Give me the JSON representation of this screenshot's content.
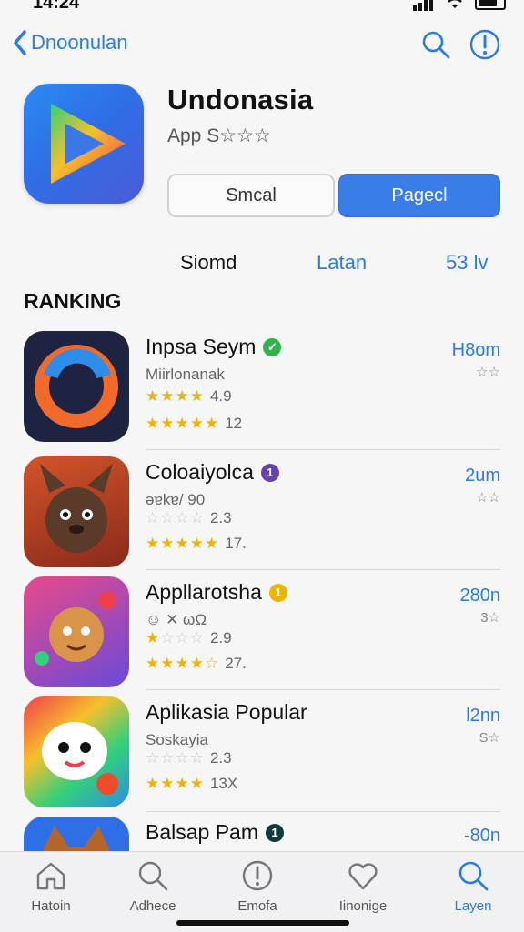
{
  "status": {
    "time": "14:24"
  },
  "nav": {
    "back_label": "Dnoonulan"
  },
  "app": {
    "title": "Undonasia",
    "subtitle": "App S☆☆☆",
    "button_outline": "Smcal",
    "button_primary": "Pagecl"
  },
  "tabs": [
    "Siomd",
    "Latan",
    "53 lv"
  ],
  "section_title": "RANKING",
  "apps": [
    {
      "name": "Inpsa Seym",
      "developer": "Miirlonanak",
      "rating1": "4.9",
      "rating2": "12",
      "right": "H8om",
      "right2": "☆☆",
      "badge_color": "#2fb34a",
      "badge_text": "✓"
    },
    {
      "name": "Coloaiyolca",
      "developer": "ǝɐkɐ/ 90",
      "rating1": "2.3",
      "rating2": "17.",
      "right": "2um",
      "right2": "☆☆",
      "badge_color": "#6a3fb0",
      "badge_text": "1"
    },
    {
      "name": "Appllarotsha",
      "developer": "☺ ✕ ωΩ",
      "rating1": "2.9",
      "rating2": "27.",
      "right": "280n",
      "right2": "3☆",
      "badge_color": "#f0b400",
      "badge_text": "1"
    },
    {
      "name": "Aplikasia Popular",
      "developer": "Soskayia",
      "rating1": "2.3",
      "rating2": "13X",
      "right": "l2nn",
      "right2": "S☆",
      "badge_color": "",
      "badge_text": ""
    },
    {
      "name": "Balsap Pam",
      "developer": "",
      "rating1": "",
      "rating2": "",
      "right": "-80n",
      "right2": "",
      "badge_color": "#123a3a",
      "badge_text": "1"
    }
  ],
  "tabbar": [
    "Hatoin",
    "Adhece",
    "Emofa",
    "Iinonige",
    "Layen"
  ],
  "colors": {
    "accent": "#2a7be6",
    "star": "#f0b400"
  }
}
